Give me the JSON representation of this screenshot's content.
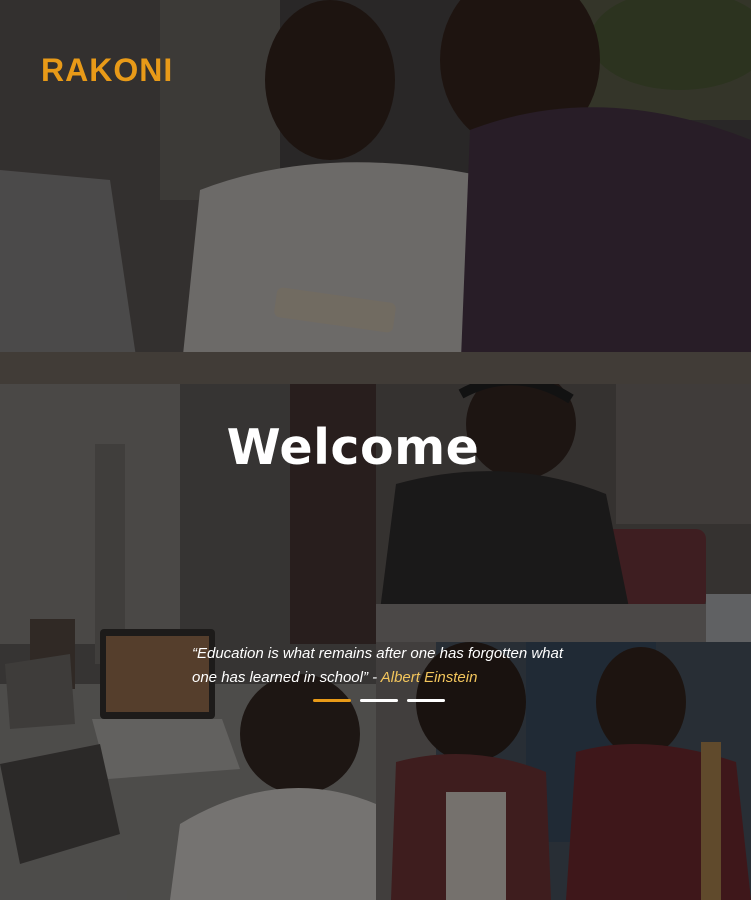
{
  "brand": {
    "name": "RAKONI",
    "color": "#e89a18"
  },
  "hero": {
    "heading": "Welcome"
  },
  "quote": {
    "text": "“Education is what remains after one has forgotten what one has learned in school”",
    "separator": " - ",
    "author": "Albert Einstein",
    "author_color": "#f2c55c"
  },
  "carousel": {
    "slide_count": 3,
    "active_index": 0
  },
  "photos": [
    {
      "name": "couple-with-phone-photo"
    },
    {
      "name": "child-video-call-photo"
    },
    {
      "name": "student-with-headphones-photo"
    },
    {
      "name": "students-laughing-photo"
    }
  ]
}
